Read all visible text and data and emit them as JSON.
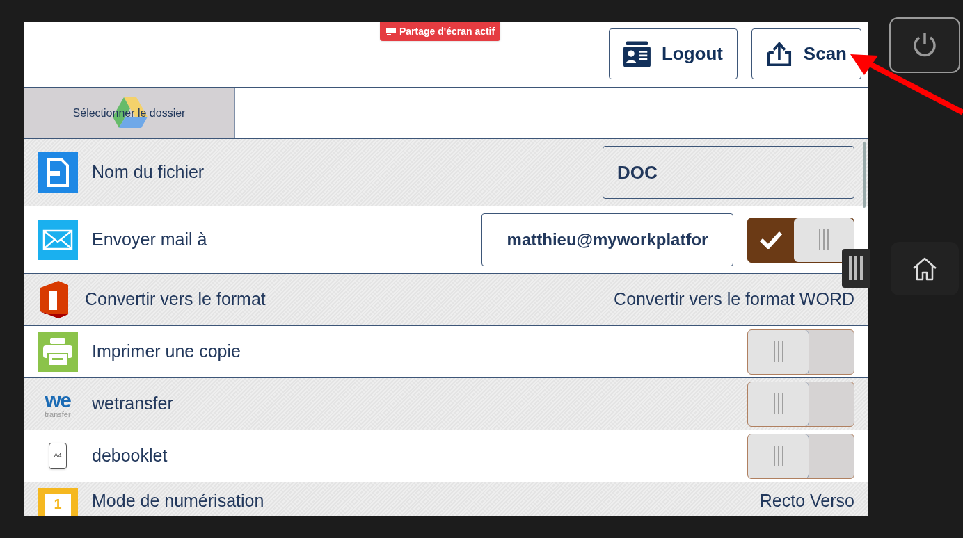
{
  "screen_share_badge": "Partage d'écran actif",
  "header_buttons": [
    {
      "label": "Logout",
      "kind": "logout"
    },
    {
      "label": "Scan",
      "kind": "scan"
    }
  ],
  "folder_button": "Sélectionner le dossier",
  "rows": [
    {
      "kind": "field",
      "label": "Nom du fichier",
      "value": "DOC"
    },
    {
      "kind": "field_toggle",
      "label": "Envoyer mail à",
      "value": "matthieu@myworkplatfor",
      "on": true
    },
    {
      "kind": "value",
      "label": "Convertir vers le format",
      "value": "Convertir vers le format WORD"
    },
    {
      "kind": "toggle",
      "label": "Imprimer une copie",
      "on": false
    },
    {
      "kind": "toggle",
      "label": "wetransfer",
      "icon_text": "we",
      "icon_caption": "transfer",
      "on": false
    },
    {
      "kind": "toggle",
      "label": "debooklet",
      "icon_text": "A4",
      "on": false
    },
    {
      "kind": "value",
      "label": "Mode de numérisation",
      "icon_text": "1",
      "value": "Recto Verso"
    }
  ]
}
